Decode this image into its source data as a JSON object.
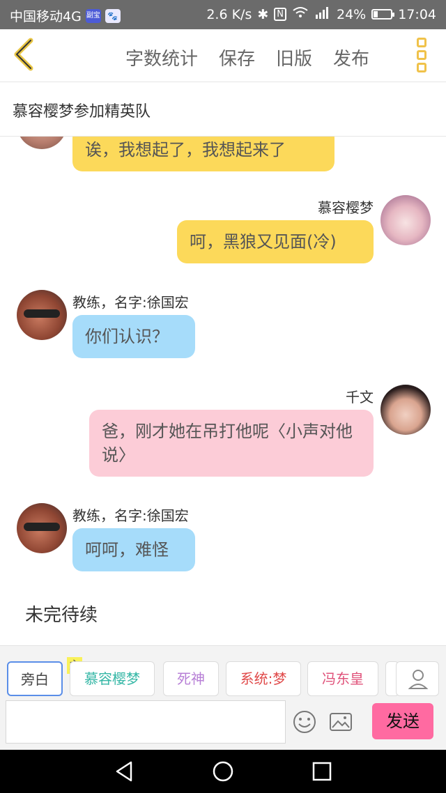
{
  "status": {
    "carrier": "中国移动4G",
    "badge1": "副宝",
    "badge2": "🐾",
    "speed": "2.6 K/s",
    "battery": "24%",
    "battery_level": 0.24,
    "time": "17:04"
  },
  "header": {
    "actions": [
      "字数统计",
      "保存",
      "旧版",
      "发布"
    ]
  },
  "story": {
    "title": "慕容樱梦参加精英队"
  },
  "messages": [
    {
      "side": "left",
      "speaker": "",
      "text": "诶，我想起了，我想起来了",
      "color": "yellow"
    },
    {
      "side": "right",
      "speaker": "慕容樱梦",
      "text": "呵，黑狼又见面(冷)",
      "color": "yellow"
    },
    {
      "side": "left",
      "speaker": "教练，名字:徐国宏",
      "text": "你们认识？",
      "color": "blue"
    },
    {
      "side": "right",
      "speaker": "千文",
      "text": "爸，刚才她在吊打他呢〈小声对他说〉",
      "color": "pink"
    },
    {
      "side": "left",
      "speaker": "教练，名字:徐国宏",
      "text": "呵呵，难怪",
      "color": "blue"
    }
  ],
  "narration": "未完待续",
  "roles": {
    "main_tag": "主",
    "items": [
      {
        "label": "旁白",
        "color": "#444444"
      },
      {
        "label": "慕容樱梦",
        "color": "#35b7a6"
      },
      {
        "label": "死神",
        "color": "#b77fd6"
      },
      {
        "label": "系统:梦",
        "color": "#e04a4a"
      },
      {
        "label": "冯东皇",
        "color": "#e0527a"
      }
    ]
  },
  "composer": {
    "send_label": "发送"
  }
}
